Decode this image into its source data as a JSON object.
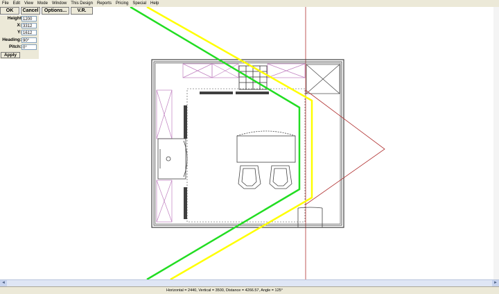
{
  "menu": [
    "File",
    "Edit",
    "View",
    "Mode",
    "Window",
    "This Design",
    "Reports",
    "Pricing",
    "Special",
    "Help"
  ],
  "toolbar": {
    "ok": "OK",
    "cancel": "Cancel",
    "options": "Options...",
    "vr": "V.R."
  },
  "fields": {
    "height": {
      "label": "Height",
      "value": "1200"
    },
    "x": {
      "label": "X:",
      "value": "3312"
    },
    "y": {
      "label": "Y:",
      "value": "1612"
    },
    "heading": {
      "label": "Heading:",
      "value": "90°"
    },
    "pitch": {
      "label": "Pitch:",
      "value": "0°"
    }
  },
  "apply_label": "Apply",
  "status": "Horizontal = 2440, Vertical = 3500, Distance = 4266.57, Angle = 125°",
  "scroll": {
    "left": "◄",
    "right": "►"
  },
  "colors": {
    "view_frustum_green": "#22dd22",
    "view_frustum_yellow": "#ffff00",
    "guide_red": "#b03030",
    "cabinet_pink": "#c080c0",
    "wall": "#404040"
  }
}
